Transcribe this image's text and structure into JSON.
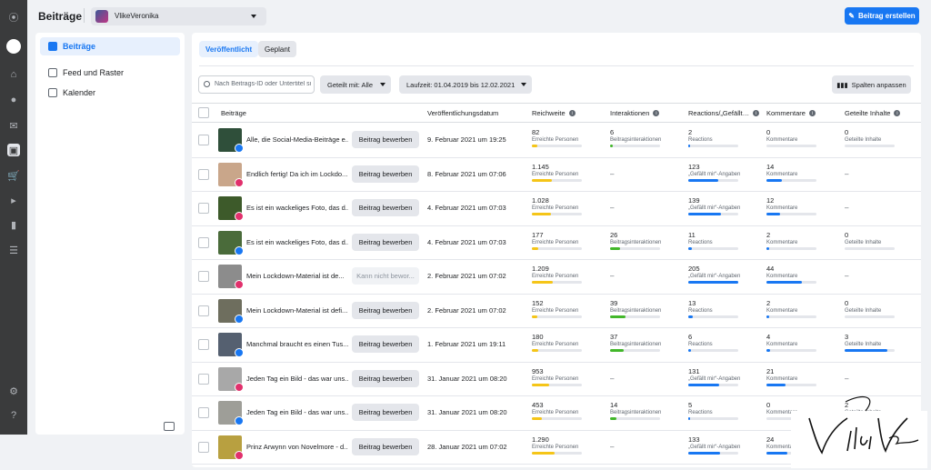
{
  "app": {
    "title": "Beiträge",
    "page_name": "VlikeVeronika",
    "create_label": "Beitrag erstellen"
  },
  "sidebar": {
    "items": [
      {
        "label": "Beiträge",
        "active": true
      },
      {
        "label": "Feed und Raster",
        "active": false
      },
      {
        "label": "Kalender",
        "active": false
      }
    ]
  },
  "tabs": [
    {
      "label": "Veröffentlicht"
    },
    {
      "label": "Geplant"
    }
  ],
  "filters": {
    "search_placeholder": "Nach Beitrags-ID oder Untertitel suchen",
    "shared_with": "Geteilt mit: Alle",
    "date_range": "Laufzeit: 01.04.2019 bis 12.02.2021",
    "columns_label": "Spalten anpassen"
  },
  "columns": [
    "Beiträge",
    "Veröffentlichungsdatum",
    "Reichweite",
    "Interaktionen",
    "Reactions/„Gefällt…",
    "Kommentare",
    "Geteilte Inhalte"
  ],
  "colors": {
    "accent": "#1877f2",
    "reach_bar": "#f5c518",
    "interaction_bar": "#42b72a",
    "reaction_bar": "#1877f2"
  },
  "rows": [
    {
      "network": "facebook",
      "text": "Alle, die Social-Media-Beiträge e...",
      "action": "Beitrag bewerben",
      "disabled": false,
      "date": "9. Februar 2021 um 19:25",
      "reach": {
        "value": "82",
        "label": "Erreichte Personen",
        "level": 0.1
      },
      "interactions": {
        "value": "6",
        "label": "Beitragsinteraktionen",
        "level": 0.05
      },
      "reactions": {
        "value": "2",
        "label": "Reactions",
        "level": 0.04
      },
      "comments": {
        "value": "0",
        "label": "Kommentare",
        "level": 0
      },
      "shares": {
        "value": "0",
        "label": "Geteilte Inhalte",
        "level": 0
      }
    },
    {
      "network": "instagram",
      "text": "Endlich fertig! Da ich im Lockdo...",
      "action": "Beitrag bewerben",
      "disabled": false,
      "date": "8. Februar 2021 um 07:06",
      "reach": {
        "value": "1.145",
        "label": "Erreichte Personen",
        "level": 0.4
      },
      "interactions": null,
      "reactions": {
        "value": "123",
        "label": "„Gefällt mir“-Angaben",
        "level": 0.6
      },
      "comments": {
        "value": "14",
        "label": "Kommentare",
        "level": 0.3
      },
      "shares": null
    },
    {
      "network": "instagram",
      "text": "Es ist ein wackeliges Foto, das d...",
      "action": "Beitrag bewerben",
      "disabled": false,
      "date": "4. Februar 2021 um 07:03",
      "reach": {
        "value": "1.028",
        "label": "Erreichte Personen",
        "level": 0.38
      },
      "interactions": null,
      "reactions": {
        "value": "139",
        "label": "„Gefällt mir“-Angaben",
        "level": 0.65
      },
      "comments": {
        "value": "12",
        "label": "Kommentare",
        "level": 0.27
      },
      "shares": null
    },
    {
      "network": "facebook",
      "text": "Es ist ein wackeliges Foto, das d...",
      "action": "Beitrag bewerben",
      "disabled": false,
      "date": "4. Februar 2021 um 07:03",
      "reach": {
        "value": "177",
        "label": "Erreichte Personen",
        "level": 0.12
      },
      "interactions": {
        "value": "26",
        "label": "Beitragsinteraktionen",
        "level": 0.2
      },
      "reactions": {
        "value": "11",
        "label": "Reactions",
        "level": 0.08
      },
      "comments": {
        "value": "2",
        "label": "Kommentare",
        "level": 0.05
      },
      "shares": {
        "value": "0",
        "label": "Geteilte Inhalte",
        "level": 0
      }
    },
    {
      "network": "instagram",
      "text": "Mein Lockdown-Material ist de...",
      "action": "Kann nicht bewor...",
      "disabled": true,
      "date": "2. Februar 2021 um 07:02",
      "reach": {
        "value": "1.209",
        "label": "Erreichte Personen",
        "level": 0.42
      },
      "interactions": null,
      "reactions": {
        "value": "205",
        "label": "„Gefällt mir“-Angaben",
        "level": 1.0
      },
      "comments": {
        "value": "44",
        "label": "Kommentare",
        "level": 0.7
      },
      "shares": null
    },
    {
      "network": "facebook",
      "text": "Mein Lockdown-Material ist defi...",
      "action": "Beitrag bewerben",
      "disabled": false,
      "date": "2. Februar 2021 um 07:02",
      "reach": {
        "value": "152",
        "label": "Erreichte Personen",
        "level": 0.11
      },
      "interactions": {
        "value": "39",
        "label": "Beitragsinteraktionen",
        "level": 0.3
      },
      "reactions": {
        "value": "13",
        "label": "Reactions",
        "level": 0.09
      },
      "comments": {
        "value": "2",
        "label": "Kommentare",
        "level": 0.05
      },
      "shares": {
        "value": "0",
        "label": "Geteilte Inhalte",
        "level": 0
      }
    },
    {
      "network": "facebook",
      "text": "Manchmal braucht es einen Tus...",
      "action": "Beitrag bewerben",
      "disabled": false,
      "date": "1. Februar 2021 um 19:11",
      "reach": {
        "value": "180",
        "label": "Erreichte Personen",
        "level": 0.12
      },
      "interactions": {
        "value": "37",
        "label": "Beitragsinteraktionen",
        "level": 0.28
      },
      "reactions": {
        "value": "6",
        "label": "Reactions",
        "level": 0.05
      },
      "comments": {
        "value": "4",
        "label": "Kommentare",
        "level": 0.08
      },
      "shares": {
        "value": "3",
        "label": "Geteilte Inhalte",
        "level": 0.85
      }
    },
    {
      "network": "instagram",
      "text": "Jeden Tag ein Bild - das war uns...",
      "action": "Beitrag bewerben",
      "disabled": false,
      "date": "31. Januar 2021 um 08:20",
      "reach": {
        "value": "953",
        "label": "Erreichte Personen",
        "level": 0.35
      },
      "interactions": null,
      "reactions": {
        "value": "131",
        "label": "„Gefällt mir“-Angaben",
        "level": 0.62
      },
      "comments": {
        "value": "21",
        "label": "Kommentare",
        "level": 0.38
      },
      "shares": null
    },
    {
      "network": "facebook",
      "text": "Jeden Tag ein Bild - das war uns...",
      "action": "Beitrag bewerben",
      "disabled": false,
      "date": "31. Januar 2021 um 08:20",
      "reach": {
        "value": "453",
        "label": "Erreichte Personen",
        "level": 0.2
      },
      "interactions": {
        "value": "14",
        "label": "Beitragsinteraktionen",
        "level": 0.12
      },
      "reactions": {
        "value": "5",
        "label": "Reactions",
        "level": 0.04
      },
      "comments": {
        "value": "0",
        "label": "Kommentare",
        "level": 0
      },
      "shares": {
        "value": "2",
        "label": "Geteilte Inhalte",
        "level": 0.6
      }
    },
    {
      "network": "instagram",
      "text": "Prinz Arwynn von Novelmore - d...",
      "action": "Beitrag bewerben",
      "disabled": false,
      "date": "28. Januar 2021 um 07:02",
      "reach": {
        "value": "1.290",
        "label": "Erreichte Personen",
        "level": 0.45
      },
      "interactions": null,
      "reactions": {
        "value": "133",
        "label": "„Gefällt mir“-Angaben",
        "level": 0.63
      },
      "comments": {
        "value": "24",
        "label": "Kommentare",
        "level": 0.42
      },
      "shares": null
    }
  ],
  "signature": "VlikeVeronika"
}
